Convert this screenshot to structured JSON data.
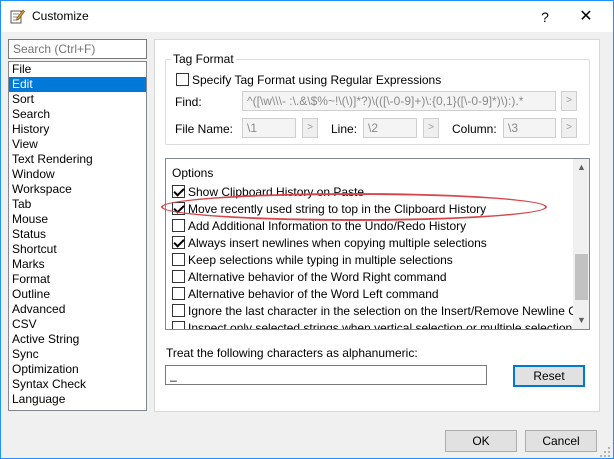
{
  "window": {
    "title": "Customize",
    "help_label": "?",
    "close_label": "✕"
  },
  "search": {
    "placeholder": "Search (Ctrl+F)"
  },
  "categories": [
    "File",
    "Edit",
    "Sort",
    "Search",
    "History",
    "View",
    "Text Rendering",
    "Window",
    "Workspace",
    "Tab",
    "Mouse",
    "Status",
    "Shortcut",
    "Marks",
    "Format",
    "Outline",
    "Advanced",
    "CSV",
    "Active String",
    "Sync",
    "Optimization",
    "Syntax Check",
    "Language"
  ],
  "selected_category": "Edit",
  "tag_format": {
    "group_label": "Tag Format",
    "regex_checkbox_label": "Specify Tag Format using Regular Expressions",
    "regex_checked": false,
    "find_label": "Find:",
    "find_value": "^([\\w\\\\\\- :\\.&\\$%~!\\(\\)]*?)\\(([\\-0-9]+)\\:{0,1}([\\-0-9]*)\\):).*",
    "file_name_label": "File Name:",
    "file_name_value": "\\1",
    "line_label": "Line:",
    "line_value": "\\2",
    "column_label": "Column:",
    "column_value": "\\3",
    "arrow_label": ">"
  },
  "options": {
    "group_label": "Options",
    "items": [
      {
        "label": "Show Clipboard History on Paste",
        "checked": true
      },
      {
        "label": "Move recently used string to top in the Clipboard History",
        "checked": true
      },
      {
        "label": "Add Additional Information to the Undo/Redo History",
        "checked": false
      },
      {
        "label": "Always insert newlines when copying multiple selections",
        "checked": true
      },
      {
        "label": "Keep selections while typing in multiple selections",
        "checked": false
      },
      {
        "label": "Alternative behavior of the Word Right command",
        "checked": false
      },
      {
        "label": "Alternative behavior of the Word Left command",
        "checked": false
      },
      {
        "label": "Ignore the last character in the selection on the Insert/Remove Newline Cha...",
        "checked": false
      },
      {
        "label": "Inspect only selected strings when vertical selection or multiple selections exi...",
        "checked": false
      }
    ],
    "scroll_up": "▲",
    "scroll_down": "▼"
  },
  "alnum": {
    "label": "Treat the following characters as alphanumeric:",
    "value": "_",
    "reset_label": "Reset"
  },
  "footer": {
    "ok_label": "OK",
    "cancel_label": "Cancel"
  },
  "colors": {
    "selection": "#0078d7",
    "highlight": "#d8454b"
  }
}
